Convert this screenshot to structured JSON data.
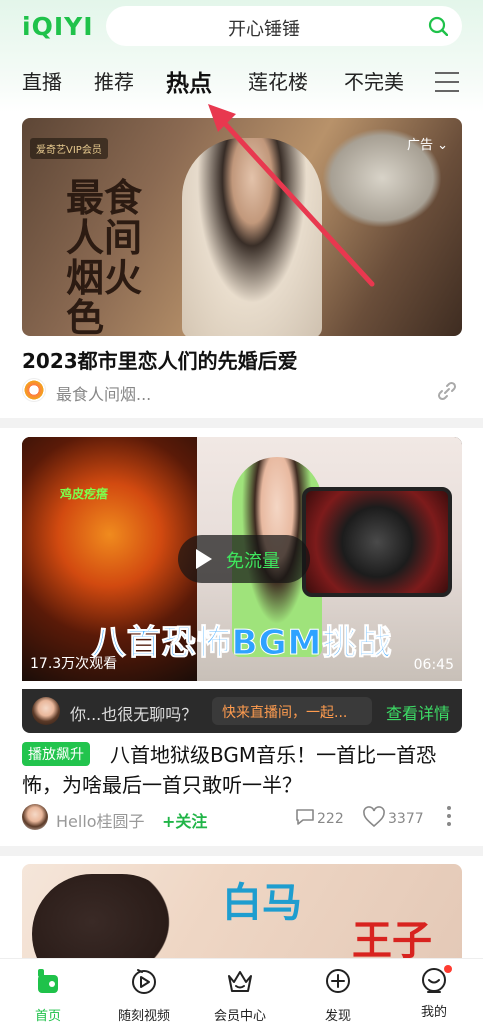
{
  "app": {
    "logo": "iQIYI",
    "accent": "#1fc24a"
  },
  "search": {
    "query": "开心锤锤"
  },
  "tabs": [
    {
      "label": "直播"
    },
    {
      "label": "推荐"
    },
    {
      "label": "热点",
      "active": true
    },
    {
      "label": "莲花楼"
    },
    {
      "label": "不完美"
    }
  ],
  "feed": {
    "card1": {
      "vip_badge": "爱奇艺VIP会员",
      "art_title": "最食人间烟火色",
      "ad_label": "广告",
      "title": "2023都市里恋人们的先婚后爱",
      "source": "最食人间烟..."
    },
    "card2": {
      "image_tag": "鸡皮疙瘩",
      "play_label": "免流量",
      "banner": "八首恐怖BGM挑战",
      "views": "17.3万次观看",
      "duration": "06:45",
      "live": {
        "text": "你...也很无聊吗？",
        "pill": "快来直播间，一起...",
        "detail": "查看详情"
      },
      "tag": "播放飙升",
      "title": "八首地狱级BGM音乐！一首比一首恐怖，为啥最后一首只敢听一半？",
      "author": "Hello桂圆子",
      "follow": "+关注",
      "comments": "222",
      "likes": "3377"
    },
    "card3": {
      "line1": "白马",
      "line2": "王子"
    }
  },
  "bottom_nav": [
    {
      "label": "首页",
      "icon": "home-icon",
      "active": true
    },
    {
      "label": "随刻视频",
      "icon": "play-circle-icon"
    },
    {
      "label": "会员中心",
      "icon": "crown-icon"
    },
    {
      "label": "发现",
      "icon": "plus-circle-icon"
    },
    {
      "label": "我的",
      "icon": "profile-icon",
      "badge": true
    }
  ]
}
